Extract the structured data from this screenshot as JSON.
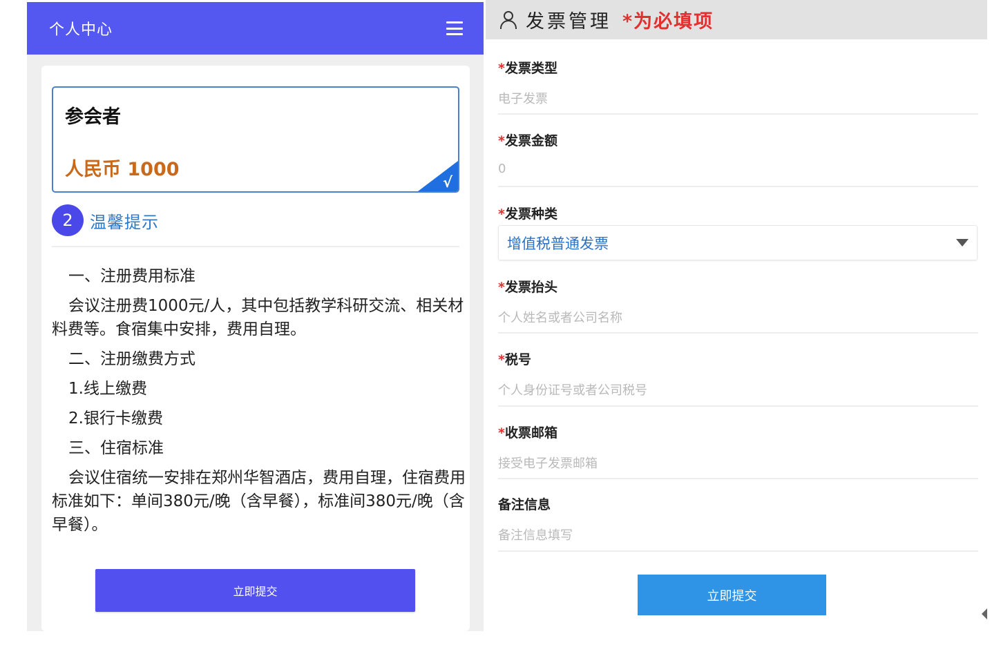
{
  "left": {
    "header_title": "个人中心",
    "ticket": {
      "role": "参会者",
      "price": "人民币 1000",
      "check": "√"
    },
    "tip": {
      "number": "2",
      "title": "温馨提示"
    },
    "rules": [
      "一、注册费用标准",
      "会议注册费1000元/人，其中包括教学科研交流、相关材料费等。食宿集中安排，费用自理。",
      "二、注册缴费方式",
      "1.线上缴费",
      "2.银行卡缴费",
      "三、住宿标准",
      "会议住宿统一安排在郑州华智酒店，费用自理，住宿费用标准如下：单间380元/晚（含早餐），标准间380元/晚（含早餐）。"
    ],
    "submit_label": "立即提交"
  },
  "right": {
    "header_title": "发票管理",
    "required_note": "*为必填项",
    "fields": [
      {
        "star": "*",
        "label": "发票类型",
        "value": "电子发票"
      },
      {
        "star": "*",
        "label": "发票金额",
        "value": "0"
      },
      {
        "star": "*",
        "label": "发票种类",
        "value": "增值税普通发票"
      },
      {
        "star": "*",
        "label": "发票抬头",
        "placeholder": "个人姓名或者公司名称"
      },
      {
        "star": "*",
        "label": "税号",
        "placeholder": "个人身份证号或者公司税号"
      },
      {
        "star": "*",
        "label": "收票邮箱",
        "placeholder": "接受电子发票邮箱"
      },
      {
        "star": "",
        "label": "备注信息",
        "placeholder": "备注信息填写"
      }
    ],
    "submit_label": "立即提交"
  },
  "colors": {
    "left_header": "#5458f0",
    "ticket_price": "#c8691c",
    "tip_title": "#2d79c7",
    "required": "#e23030",
    "select_value": "#2b72c7",
    "right_submit": "#2f94e6"
  },
  "icons": [
    "menu-icon",
    "check-icon",
    "user-icon",
    "caret-down-icon"
  ]
}
